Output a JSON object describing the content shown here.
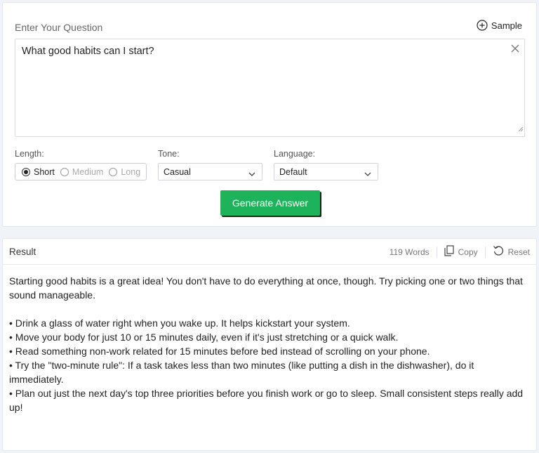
{
  "question": {
    "label": "Enter Your Question",
    "sample_label": "Sample",
    "value": "What good habits can I start?"
  },
  "options": {
    "length_label": "Length:",
    "length_choices": [
      "Short",
      "Medium",
      "Long"
    ],
    "length_selected": "Short",
    "tone_label": "Tone:",
    "tone_value": "Casual",
    "language_label": "Language:",
    "language_value": "Default"
  },
  "generate_label": "Generate Answer",
  "result": {
    "title": "Result",
    "word_count": "119 Words",
    "copy_label": "Copy",
    "reset_label": "Reset",
    "intro": "Starting good habits is a great idea! You don't have to do everything at once, though. Try picking one or two things that sound manageable.",
    "bullets": [
      "• Drink a glass of water right when you wake up. It helps kickstart your system.",
      "• Move your body for just 10 or 15 minutes daily, even if it's just stretching or a quick walk.",
      "• Read something non-work related for 15 minutes before bed instead of scrolling on your phone.",
      "• Try the \"two-minute rule\": If a task takes less than two minutes (like putting a dish in the dishwasher), do it immediately.",
      "• Plan out just the next day's top three priorities before you finish work or go to sleep. Small consistent steps really add up!"
    ]
  },
  "colors": {
    "accent_green": "#1db35a",
    "page_bg": "#f0f3f7"
  }
}
